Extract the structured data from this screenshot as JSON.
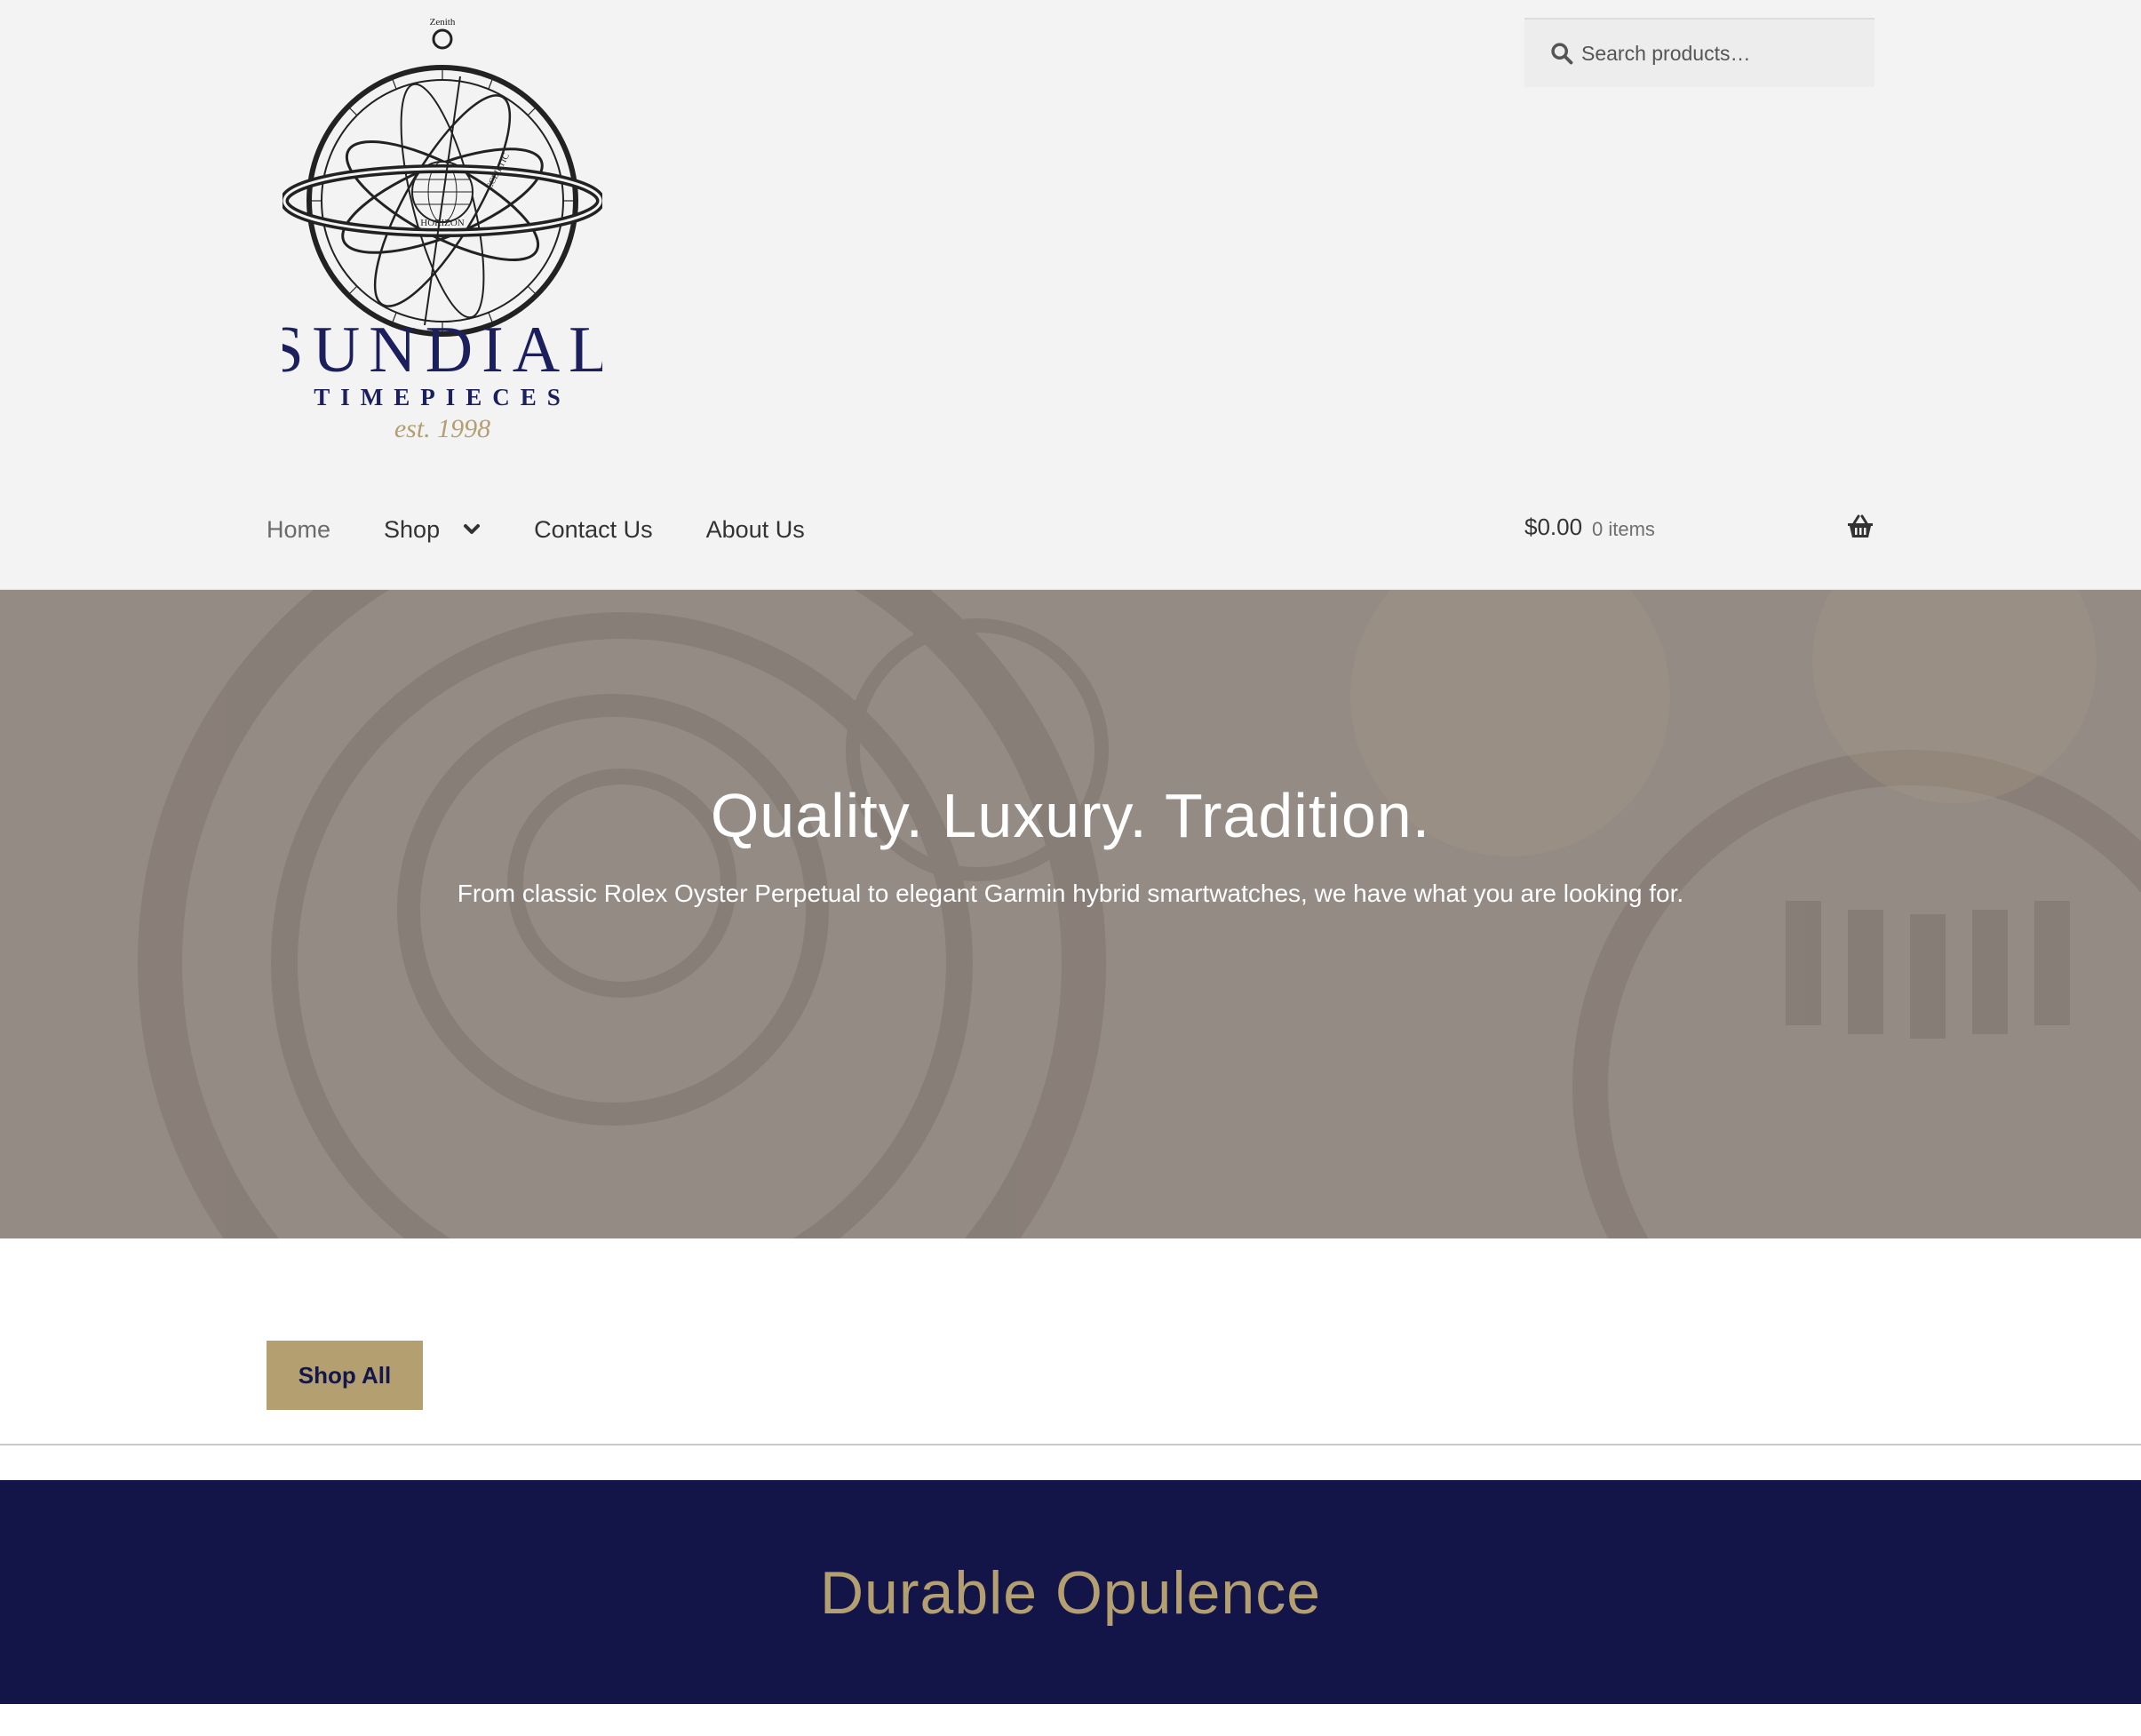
{
  "brand": {
    "logo_word": "SUNDIAL",
    "logo_sub": "TIMEPIECES",
    "logo_est": "est. 1998",
    "logo_zenith": "Zenith",
    "logo_horizon": "HORIZON",
    "logo_ecliptic": "ECLIPTIC",
    "colors": {
      "navy": "#131548",
      "gold": "#b39f6f",
      "header_bg": "#f3f3f3"
    }
  },
  "search": {
    "placeholder": "Search products…",
    "icon": "search-icon"
  },
  "nav": {
    "items": [
      {
        "label": "Home"
      },
      {
        "label": "Shop",
        "has_dropdown": true
      },
      {
        "label": "Contact Us"
      },
      {
        "label": "About Us"
      }
    ]
  },
  "cart": {
    "total": "$0.00",
    "count": "0 items",
    "icon": "basket-icon"
  },
  "hero": {
    "title": "Quality. Luxury. Tradition.",
    "subtitle": "From classic Rolex Oyster Perpetual to elegant Garmin hybrid smartwatches, we have what you are looking for."
  },
  "cta": {
    "shop_all": "Shop All"
  },
  "band": {
    "title": "Durable Opulence"
  }
}
